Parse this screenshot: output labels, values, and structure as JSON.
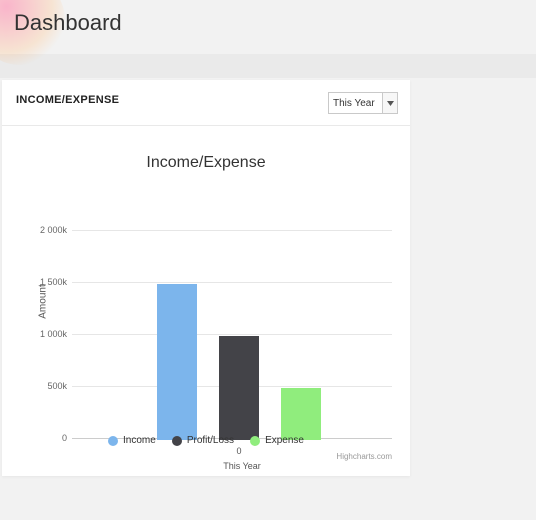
{
  "page_title": "Dashboard",
  "card": {
    "title": "INCOME/EXPENSE",
    "timeframe_selected": "This Year"
  },
  "chart_data": {
    "type": "bar",
    "title": "Income/Expense",
    "ylabel": "Amount",
    "xlabel": "This Year",
    "xtick": "0",
    "ylim": [
      0,
      2000000
    ],
    "yticks": [
      "0",
      "500k",
      "1 000k",
      "1 500k",
      "2 000k"
    ],
    "series": [
      {
        "name": "Income",
        "color": "#7cb5ec",
        "value": 1500000
      },
      {
        "name": "Profit/Loss",
        "color": "#434348",
        "value": 1000000
      },
      {
        "name": "Expense",
        "color": "#90ed7d",
        "value": 500000
      }
    ],
    "credit": "Highcharts.com"
  },
  "colors": {
    "income": "#7cb5ec",
    "profit": "#434348",
    "expense": "#90ed7d"
  }
}
